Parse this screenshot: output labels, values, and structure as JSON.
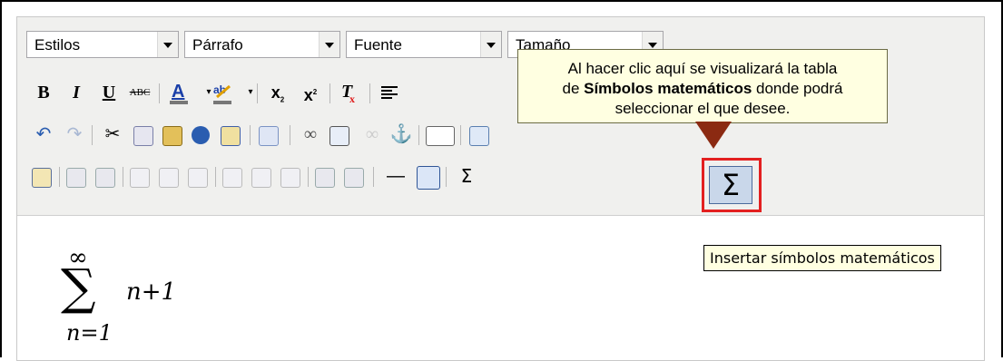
{
  "combos": {
    "styles": "Estilos",
    "format": "Párrafo",
    "font": "Fuente",
    "size": "Tamaño"
  },
  "toolbar": {
    "bold": "B",
    "italic": "I",
    "underline": "U",
    "strike": "ABC",
    "sub": "x",
    "sup": "x",
    "hr_glyph": "—",
    "sigma_small": "Σ",
    "sigma_big": "Σ"
  },
  "callout": {
    "line1": "Al hacer clic aquí se visualizará la tabla",
    "line2_prefix": "de ",
    "line2_bold": "Símbolos matemáticos",
    "line2_suffix": " donde podrá",
    "line3": "seleccionar el que desee."
  },
  "tooltip": "Insertar símbolos matemáticos",
  "content": {
    "upper_limit": "∞",
    "sum_symbol": "∑",
    "lower_limit": "n=1",
    "expression": "n+1"
  }
}
